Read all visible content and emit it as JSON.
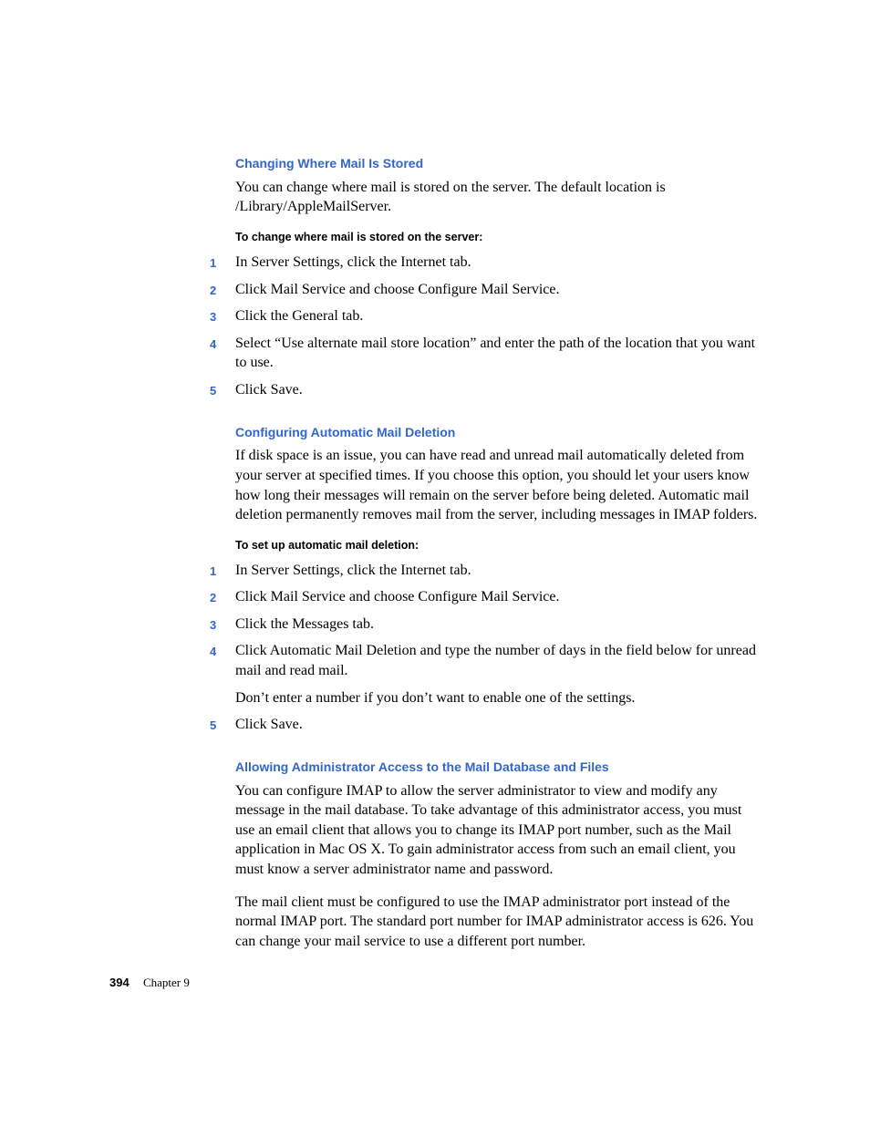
{
  "sections": [
    {
      "heading": "Changing Where Mail Is Stored",
      "paragraphs": [
        "You can change where mail is stored on the server. The default location is /Library/AppleMailServer."
      ],
      "subhead": "To change where mail is stored on the server:",
      "steps": [
        {
          "n": "1",
          "text": "In Server Settings, click the Internet tab."
        },
        {
          "n": "2",
          "text": "Click Mail Service and choose Configure Mail Service."
        },
        {
          "n": "3",
          "text": "Click the General tab."
        },
        {
          "n": "4",
          "text": "Select “Use alternate mail store location” and enter the path of the location that you want to use."
        },
        {
          "n": "5",
          "text": "Click Save."
        }
      ]
    },
    {
      "heading": "Configuring Automatic Mail Deletion",
      "paragraphs": [
        "If disk space is an issue, you can have read and unread mail automatically deleted from your server at specified times. If you choose this option, you should let your users know how long their messages will remain on the server before being deleted. Automatic mail deletion permanently removes mail from the server, including messages in IMAP folders."
      ],
      "subhead": "To set up automatic mail deletion:",
      "steps": [
        {
          "n": "1",
          "text": "In Server Settings, click the Internet tab."
        },
        {
          "n": "2",
          "text": "Click Mail Service and choose Configure Mail Service."
        },
        {
          "n": "3",
          "text": "Click the Messages tab."
        },
        {
          "n": "4",
          "text": "Click Automatic Mail Deletion and type the number of days in the field below for unread mail and read mail.",
          "note": "Don’t enter a number if you don’t want to enable one of the settings."
        },
        {
          "n": "5",
          "text": "Click Save."
        }
      ]
    },
    {
      "heading": "Allowing Administrator Access to the Mail Database and Files",
      "paragraphs": [
        "You can configure IMAP to allow the server administrator to view and modify any message in the mail database. To take advantage of this administrator access, you must use an email client that allows you to change its IMAP port number, such as the Mail application in Mac OS X. To gain administrator access from such an email client, you must know a server administrator name and password.",
        "The mail client must be configured to use the IMAP administrator port instead of the normal IMAP port. The standard port number for IMAP administrator access is 626. You can change your mail service to use a different port number."
      ],
      "subhead": null,
      "steps": []
    }
  ],
  "footer": {
    "page": "394",
    "chapter": "Chapter 9"
  }
}
